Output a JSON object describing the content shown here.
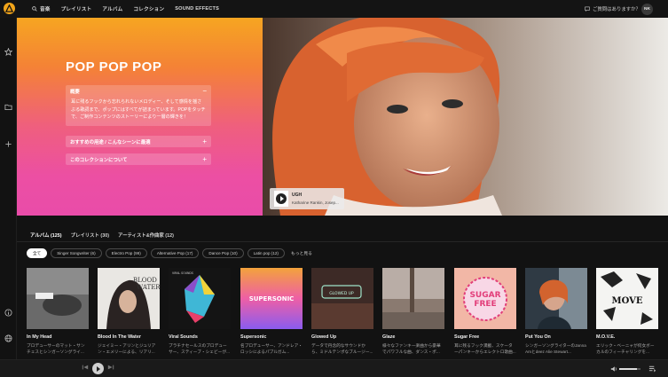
{
  "topbar": {
    "search_label": "音楽",
    "nav": [
      "プレイリスト",
      "アルバム",
      "コレクション",
      "SOUND EFFECTS"
    ],
    "help_label": "ご質問はありますか？",
    "avatar_initials": "NK"
  },
  "hero": {
    "title": "POP POP POP",
    "overview": {
      "label": "概要",
      "text": "耳に残るフックから忘れられないメロディー、そして感情を揺さぶる歌詞まで、ポップにはすべてが詰まっています。POPをタッチで、ご制作コンテンツのストーリーにより一層の輝きを！"
    },
    "uses_label": "おすすめの用途 / こんなシーンに最適",
    "about_label": "このコレクションについて",
    "track": {
      "title": "UGH",
      "artist": "Katharine Rankin, Josep..."
    }
  },
  "tabs": [
    "アルバム (125)",
    "プレイリスト (30)",
    "アーティスト&作曲家 (12)"
  ],
  "filters": [
    "全て",
    "Singer Songwriter (6)",
    "Electro Pop (99)",
    "Alternative Pop (17)",
    "Dance Pop (10)",
    "Latin pop (12)"
  ],
  "more_label": "もっと見る",
  "albums": [
    {
      "title": "In My Head",
      "desc": "プロデューサーのマット・サンチェスとシンガーソングライ..."
    },
    {
      "title": "Blood In The Water",
      "desc": "ジェイミー・アリンとジュリアン・エメリーによる、リアリ..."
    },
    {
      "title": "Viral Sounds",
      "desc": "プラチナセールスのプロデューサー、スティーブ・シェビーが..."
    },
    {
      "title": "Supersonic",
      "desc": "名プロデューサー、アンドレア・ロッシによるパブルガム..."
    },
    {
      "title": "Glowed Up",
      "desc": "データで丹念的なサウンドから、ミドルテンポなブルージー..."
    },
    {
      "title": "Glaze",
      "desc": "様々なファンキー楽曲から豪華でパワフルな曲、ダンス・ポ..."
    },
    {
      "title": "Sugar Free",
      "desc": "耳に残るフック満載、スケーターパンキーからエレクトロ歌曲..."
    },
    {
      "title": "Put You On",
      "desc": "シンガーソングライターのJanna Amとdeez Alie Stewart..."
    },
    {
      "title": "M.O.V.E.",
      "desc": "エリック・ベーニャが何女ボーカルのフィーチャリングを..."
    }
  ],
  "cover_text": {
    "blood": "BLOOD\nWATER",
    "viral": "VIRAL SOUNDS",
    "supersonic": "SUPERSONIC",
    "glowed": "GLOWED UP",
    "sugar": "SUGAR\nFREE",
    "move": "MOVE"
  },
  "player": {
    "volume": 0.85
  },
  "colors": {
    "accent": "#f2a51a",
    "background": "#121212"
  }
}
